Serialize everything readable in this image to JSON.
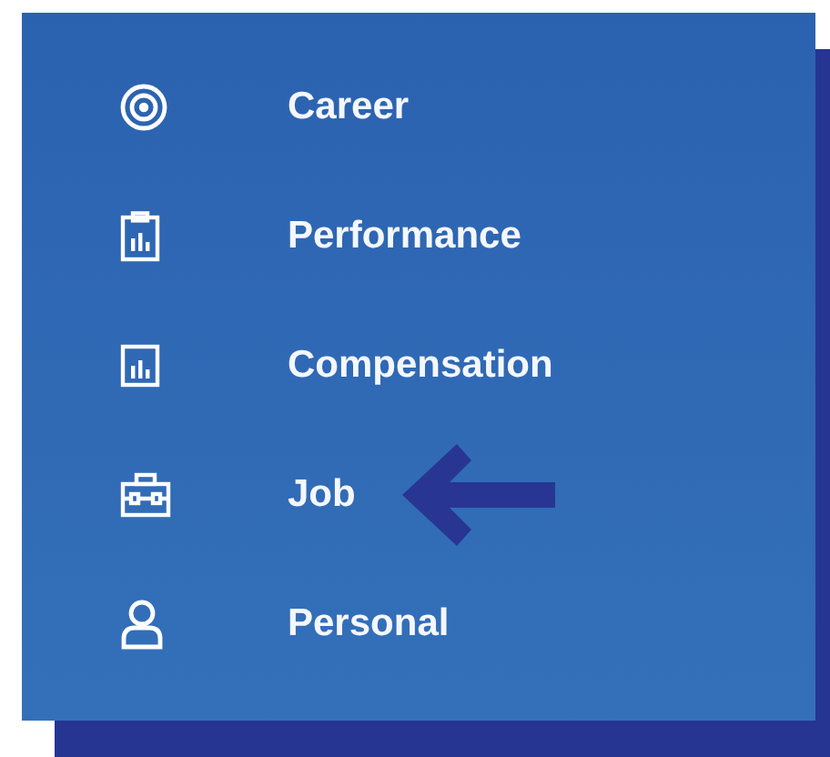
{
  "menu": {
    "items": [
      {
        "label": "Career",
        "kind": "target",
        "arrow": false
      },
      {
        "label": "Performance",
        "kind": "clipboard",
        "arrow": false
      },
      {
        "label": "Compensation",
        "kind": "chart",
        "arrow": false
      },
      {
        "label": "Job",
        "kind": "briefcase",
        "arrow": true
      },
      {
        "label": "Personal",
        "kind": "person",
        "arrow": false
      }
    ]
  }
}
